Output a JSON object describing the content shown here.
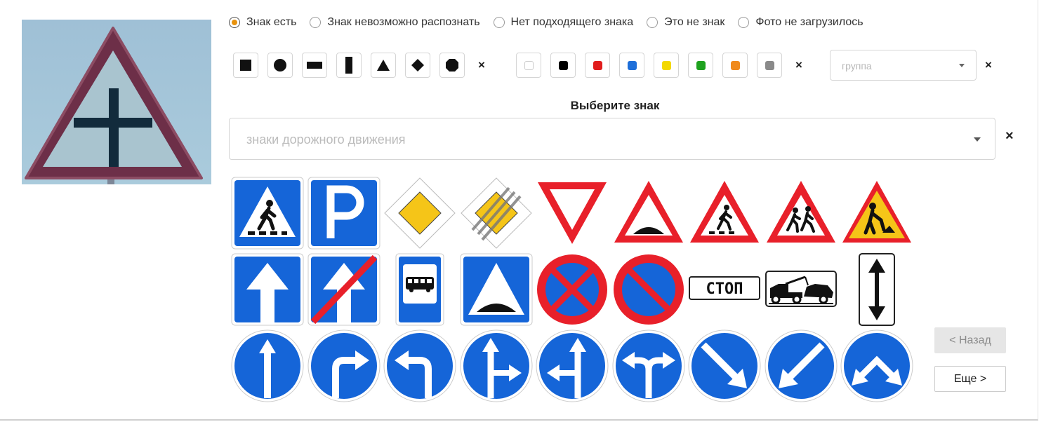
{
  "status_options": [
    {
      "label": "Знак есть",
      "selected": true
    },
    {
      "label": "Знак невозможно распознать",
      "selected": false
    },
    {
      "label": "Нет подходящего знака",
      "selected": false
    },
    {
      "label": "Это не знак",
      "selected": false
    },
    {
      "label": "Фото не загрузилось",
      "selected": false
    }
  ],
  "shape_filters": [
    "square",
    "circle",
    "wide-rectangle",
    "tall-rectangle",
    "triangle",
    "diamond",
    "octagon"
  ],
  "color_filters": [
    "#ffffff",
    "#000000",
    "#e11d1d",
    "#1e6fd9",
    "#f3d800",
    "#1fa21f",
    "#f08a1c",
    "#8a8a8a"
  ],
  "clear_symbol": "×",
  "group_placeholder": "группа",
  "select_title": "Выберите знак",
  "sign_placeholder": "знаки дорожного движения",
  "stop_sign_text": "СТОП",
  "sign_names": [
    "pedestrian-crossing",
    "parking",
    "main-road",
    "end-of-main-road",
    "give-way",
    "speed-bump-warning",
    "pedestrians-warning",
    "children-warning",
    "road-works",
    "one-way-road",
    "end-of-one-way-road",
    "bus-stop",
    "speed-bump",
    "no-stopping",
    "no-parking",
    "stop-line",
    "tow-truck",
    "two-way-traffic-board",
    "ahead-only",
    "turn-right-only",
    "turn-left-only",
    "ahead-or-right",
    "ahead-or-left",
    "left-or-right",
    "keep-right",
    "keep-left",
    "pass-either-side"
  ],
  "colors": {
    "sign_blue": "#1565d8",
    "sign_red": "#e8202a",
    "main_road_yellow": "#f5c518",
    "radio_accent": "#e8920c"
  },
  "nav": {
    "back_label": "< Назад",
    "back_enabled": false,
    "more_label": "Еще >"
  }
}
